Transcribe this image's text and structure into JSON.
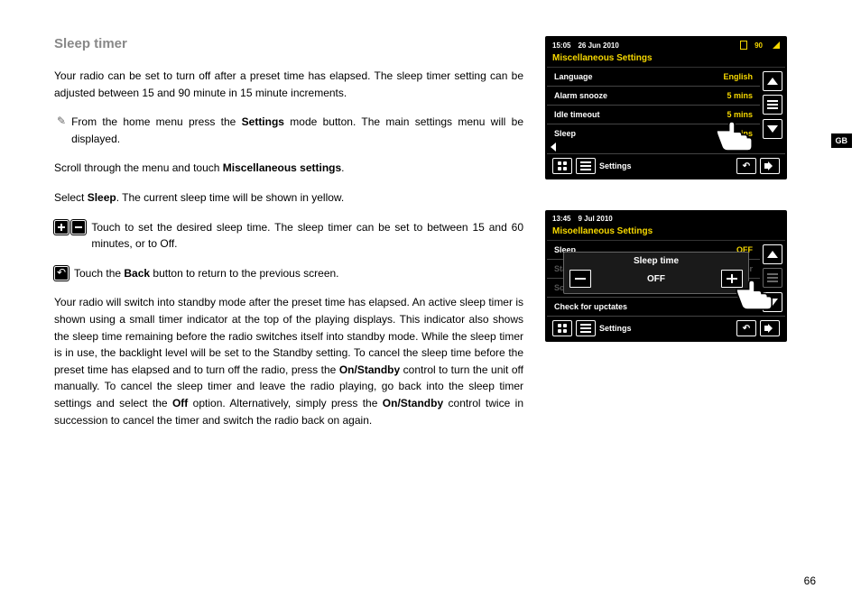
{
  "heading": "Sleep timer",
  "lang_tab": "GB",
  "page_number": "66",
  "para1_pre": "Your radio can be set to turn off after a preset time has elapsed. The sleep timer setting can be adjusted between 15 and 90 minute in 15 minute increments.",
  "step1_a": "From the home menu press the ",
  "step1_bold": "Settings",
  "step1_b": " mode button. The main settings menu will be displayed.",
  "para2_a": "Scroll through the menu and touch ",
  "para2_bold": "Miscellaneous settings",
  "para2_b": ".",
  "para3_a": "Select ",
  "para3_bold": "Sleep",
  "para3_b": ". The current sleep time will be shown in yellow.",
  "step2": "Touch to set the desired sleep time. The sleep timer can be set to between 15 and 60 minutes, or to Off.",
  "step3_a": "Touch the ",
  "step3_bold": "Back",
  "step3_b": " button to return to the previous screen.",
  "para4_a": "Your radio will switch into standby mode after the preset time has elapsed. An active sleep timer is shown using a small timer indicator at the top of the playing displays. This indicator also shows the sleep time remaining before the radio switches itself into standby mode. While the sleep timer is in use, the backlight level will be set to the Standby setting. To cancel the sleep time before the preset time has elapsed and to turn off the radio, press the ",
  "para4_bold1": "On/Standby",
  "para4_b": " control to turn the unit off manually. To cancel the sleep timer and leave the radio playing, go back into the sleep timer settings and select the ",
  "para4_bold2": "Off",
  "para4_c": " option. Alternatively, simply press the ",
  "para4_bold3": "On/Standby",
  "para4_d": " control twice in succession to cancel the timer and switch the radio back on again.",
  "device1": {
    "time": "15:05",
    "date": "26 Jun 2010",
    "battery": "90",
    "title": "Miscellaneous Settings",
    "rows": [
      {
        "label": "Language",
        "value": "English"
      },
      {
        "label": "Alarm snooze",
        "value": "5 mins"
      },
      {
        "label": "Idle timeout",
        "value": "5 mins"
      },
      {
        "label": "Sleep",
        "value": "90mins"
      }
    ],
    "footer_label": "Settings"
  },
  "device2": {
    "time": "13:45",
    "date": "9 Jul 2010",
    "title": "Misoellaneous Settings",
    "rows": [
      {
        "label": "Sleep",
        "value": "OFF"
      },
      {
        "label": "Standby backlight",
        "value": "ver"
      },
      {
        "label": "Software update",
        "value": "ed"
      },
      {
        "label": "Check for upctates",
        "value": ""
      }
    ],
    "overlay": {
      "title": "Sleep time",
      "value": "OFF"
    },
    "footer_label": "Settings"
  }
}
